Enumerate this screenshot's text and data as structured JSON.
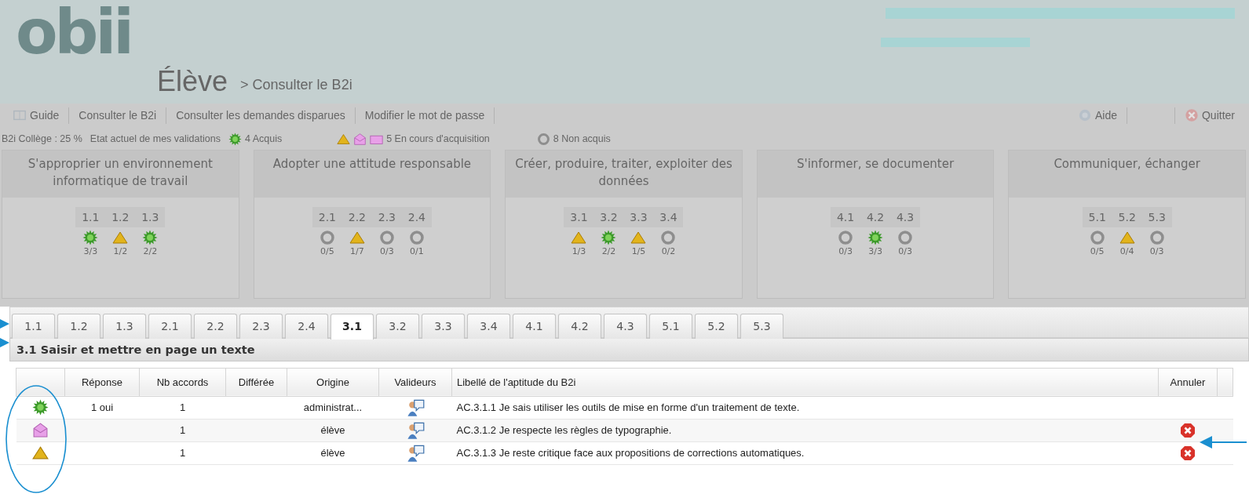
{
  "header": {
    "logo": "obii",
    "role": "Élève",
    "breadcrumb": "> Consulter le B2i"
  },
  "menu": {
    "left": [
      {
        "label": "Guide"
      },
      {
        "label": "Consulter le B2i"
      },
      {
        "label": "Consulter les demandes disparues"
      },
      {
        "label": "Modifier le mot de passe"
      }
    ],
    "right": [
      {
        "label": "Aide"
      },
      {
        "label": "Quitter"
      }
    ]
  },
  "summary": {
    "score": "B2i Collège : 25 %",
    "caption": "Etat actuel de mes validations",
    "legend": [
      {
        "icons": [
          {
            "kind": "acquis"
          }
        ],
        "label": "4 Acquis"
      },
      {
        "icons": [
          {
            "kind": "encours"
          },
          {
            "kind": "attente"
          },
          {
            "kind": "dossier"
          }
        ],
        "label": "5 En cours d'acquisition"
      },
      {
        "icons": [
          {
            "kind": "nonacquis"
          }
        ],
        "label": "8 Non acquis"
      }
    ]
  },
  "domains": [
    {
      "title": "S'approprier un environnement informatique de travail",
      "items": [
        {
          "code": "1.1",
          "kind": "acquis",
          "count": "3/3"
        },
        {
          "code": "1.2",
          "kind": "encours",
          "count": "1/2"
        },
        {
          "code": "1.3",
          "kind": "acquis",
          "count": "2/2"
        }
      ]
    },
    {
      "title": "Adopter une attitude responsable",
      "items": [
        {
          "code": "2.1",
          "kind": "nonacquis",
          "count": "0/5"
        },
        {
          "code": "2.2",
          "kind": "encours",
          "count": "1/7"
        },
        {
          "code": "2.3",
          "kind": "nonacquis",
          "count": "0/3"
        },
        {
          "code": "2.4",
          "kind": "nonacquis",
          "count": "0/1"
        }
      ]
    },
    {
      "title": "Créer, produire, traiter, exploiter des données",
      "items": [
        {
          "code": "3.1",
          "kind": "encours",
          "count": "1/3"
        },
        {
          "code": "3.2",
          "kind": "acquis",
          "count": "2/2"
        },
        {
          "code": "3.3",
          "kind": "encours",
          "count": "1/5"
        },
        {
          "code": "3.4",
          "kind": "nonacquis",
          "count": "0/2"
        }
      ]
    },
    {
      "title": "S'informer, se documenter",
      "items": [
        {
          "code": "4.1",
          "kind": "nonacquis",
          "count": "0/3"
        },
        {
          "code": "4.2",
          "kind": "acquis",
          "count": "3/3"
        },
        {
          "code": "4.3",
          "kind": "nonacquis",
          "count": "0/3"
        }
      ]
    },
    {
      "title": "Communiquer, échanger",
      "items": [
        {
          "code": "5.1",
          "kind": "nonacquis",
          "count": "0/5"
        },
        {
          "code": "5.2",
          "kind": "encours",
          "count": "0/4"
        },
        {
          "code": "5.3",
          "kind": "nonacquis",
          "count": "0/3"
        }
      ]
    }
  ],
  "tabs": [
    {
      "label": "1.1",
      "selected": false
    },
    {
      "label": "1.2",
      "selected": false
    },
    {
      "label": "1.3",
      "selected": false
    },
    {
      "label": "2.1",
      "selected": false
    },
    {
      "label": "2.2",
      "selected": false
    },
    {
      "label": "2.3",
      "selected": false
    },
    {
      "label": "2.4",
      "selected": false
    },
    {
      "label": "3.1",
      "selected": true
    },
    {
      "label": "3.2",
      "selected": false
    },
    {
      "label": "3.3",
      "selected": false
    },
    {
      "label": "3.4",
      "selected": false
    },
    {
      "label": "4.1",
      "selected": false
    },
    {
      "label": "4.2",
      "selected": false
    },
    {
      "label": "4.3",
      "selected": false
    },
    {
      "label": "5.1",
      "selected": false
    },
    {
      "label": "5.2",
      "selected": false
    },
    {
      "label": "5.3",
      "selected": false
    }
  ],
  "section_title": "3.1 Saisir et mettre en page un texte",
  "table": {
    "columns": [
      "Réponse",
      "Nb accords",
      "Différée",
      "Origine",
      "Valideurs",
      "Libellé de l'aptitude du B2i",
      "Annuler"
    ],
    "rows": [
      {
        "kind": "acquis",
        "reponse": "1 oui",
        "accords": "1",
        "origine": "administrat...",
        "libelle": "AC.3.1.1 Je sais utiliser les outils de mise en forme d'un traitement de texte.",
        "cancellable": false
      },
      {
        "kind": "attente",
        "accords": "1",
        "origine": "élève",
        "libelle": "AC.3.1.2 Je respecte les règles de typographie.",
        "cancellable": true
      },
      {
        "kind": "encours",
        "accords": "1",
        "origine": "élève",
        "libelle": "AC.3.1.3 Je reste critique face aux propositions de corrections automatiques.",
        "cancellable": true
      }
    ]
  }
}
